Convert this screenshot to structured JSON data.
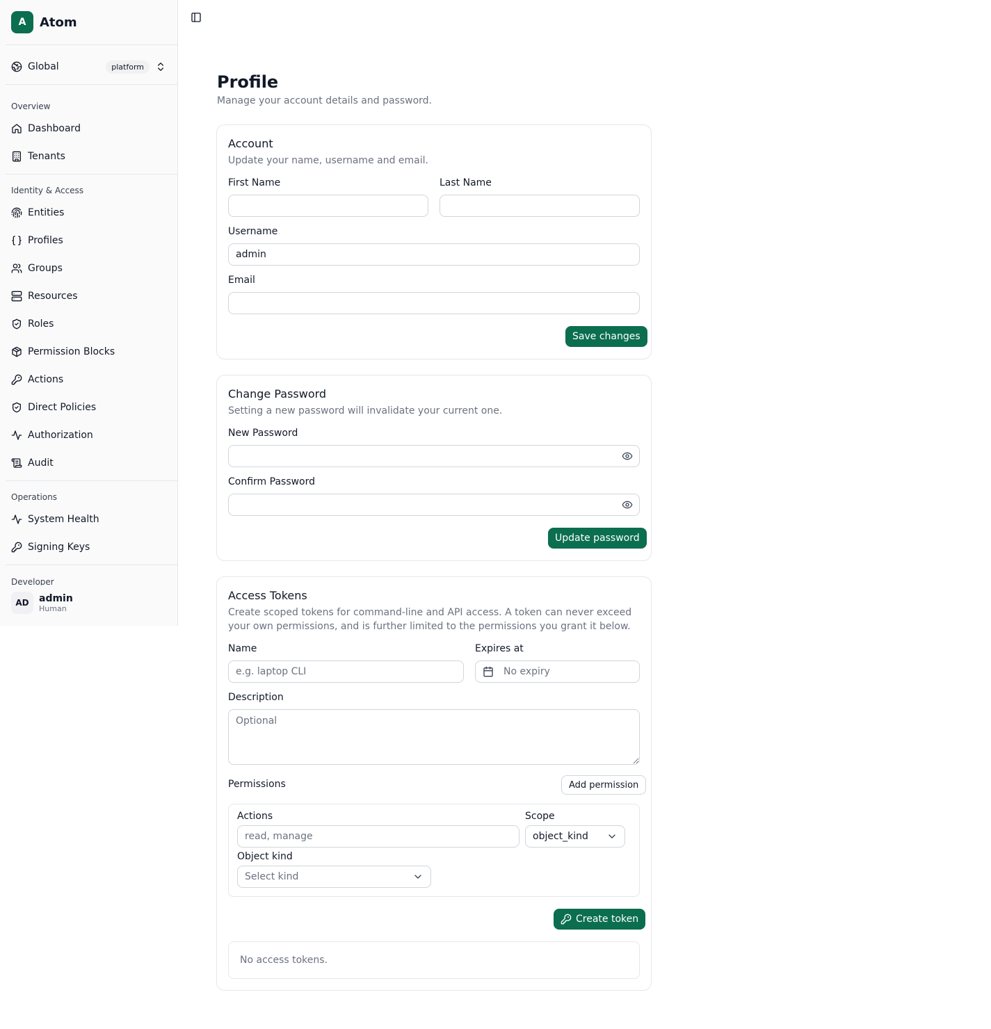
{
  "app": {
    "logo_letter": "A",
    "name": "Atom"
  },
  "tenant": {
    "label": "Global",
    "badge": "platform"
  },
  "sidebar": {
    "sections": [
      {
        "title": "Overview",
        "items": [
          {
            "label": "Dashboard",
            "icon": "home-icon"
          },
          {
            "label": "Tenants",
            "icon": "building-icon"
          }
        ]
      },
      {
        "title": "Identity & Access",
        "items": [
          {
            "label": "Entities",
            "icon": "fingerprint-icon"
          },
          {
            "label": "Profiles",
            "icon": "braces-icon"
          },
          {
            "label": "Groups",
            "icon": "users-icon"
          },
          {
            "label": "Resources",
            "icon": "server-icon"
          },
          {
            "label": "Roles",
            "icon": "shield-check-icon"
          },
          {
            "label": "Permission Blocks",
            "icon": "blocks-icon"
          },
          {
            "label": "Actions",
            "icon": "key-icon"
          },
          {
            "label": "Direct Policies",
            "icon": "shield-check-icon"
          },
          {
            "label": "Authorization",
            "icon": "activity-icon"
          },
          {
            "label": "Audit",
            "icon": "scroll-icon"
          }
        ]
      },
      {
        "title": "Operations",
        "items": [
          {
            "label": "System Health",
            "icon": "activity-icon"
          },
          {
            "label": "Signing Keys",
            "icon": "key-icon"
          }
        ]
      }
    ],
    "partial_section_title": "Developer"
  },
  "user": {
    "initials": "AD",
    "name": "admin",
    "type": "Human"
  },
  "page": {
    "title": "Profile",
    "subtitle": "Manage your account details and password."
  },
  "account": {
    "title": "Account",
    "desc": "Update your name, username and email.",
    "first_name_label": "First Name",
    "first_name_value": "",
    "last_name_label": "Last Name",
    "last_name_value": "",
    "username_label": "Username",
    "username_value": "admin",
    "email_label": "Email",
    "email_value": "",
    "save_label": "Save changes"
  },
  "password": {
    "title": "Change Password",
    "desc": "Setting a new password will invalidate your current one.",
    "new_label": "New Password",
    "confirm_label": "Confirm Password",
    "update_label": "Update password"
  },
  "tokens": {
    "title": "Access Tokens",
    "desc": "Create scoped tokens for command-line and API access. A token can never exceed your own permissions, and is further limited to the permissions you grant it below.",
    "name_label": "Name",
    "name_placeholder": "e.g. laptop CLI",
    "expires_label": "Expires at",
    "expires_value": "No expiry",
    "description_label": "Description",
    "description_placeholder": "Optional",
    "permissions_label": "Permissions",
    "add_permission_label": "Add permission",
    "actions_label": "Actions",
    "actions_placeholder": "read, manage",
    "scope_label": "Scope",
    "scope_value": "object_kind",
    "object_kind_label": "Object kind",
    "object_kind_placeholder": "Select kind",
    "create_label": "Create token",
    "empty_text": "No access tokens."
  },
  "colors": {
    "accent": "#0b6e4f",
    "border": "#e5e7eb",
    "muted": "#6b7280"
  }
}
